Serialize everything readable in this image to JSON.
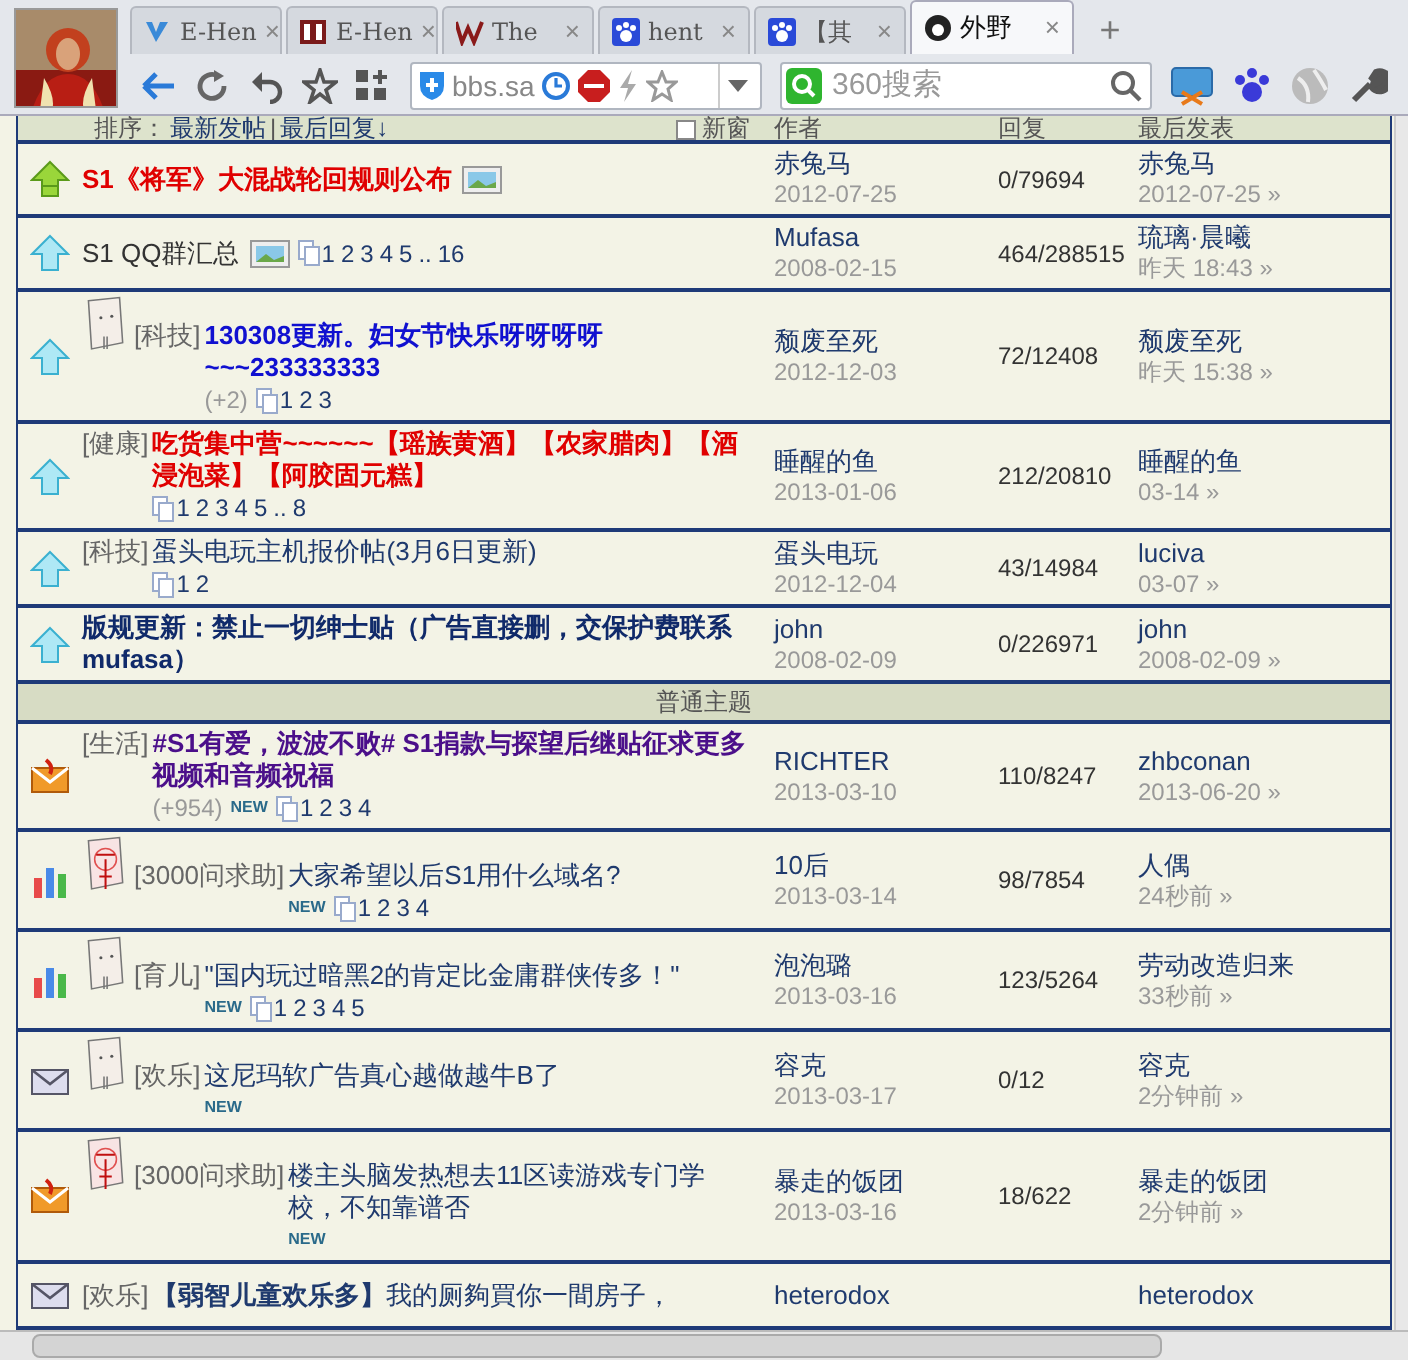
{
  "browser": {
    "tabs": [
      {
        "label": "E-Hen",
        "kind": "v",
        "close": "×",
        "selected": false
      },
      {
        "label": "E-Hen",
        "kind": "eh",
        "close": "×",
        "selected": false
      },
      {
        "label": "The",
        "kind": "w",
        "close": "×",
        "selected": false
      },
      {
        "label": "hent",
        "kind": "paw",
        "close": "×",
        "selected": false
      },
      {
        "label": "【其",
        "kind": "paw",
        "close": "×",
        "selected": false
      },
      {
        "label": "外野",
        "kind": "globe",
        "close": "×",
        "selected": true
      }
    ],
    "new_tab": "+",
    "address": "bbs.sa",
    "search_placeholder": "360搜索"
  },
  "list_header": {
    "sort_label": "排序：",
    "sort_options": [
      "最新发帖",
      "最后回复↓"
    ],
    "separator": "|",
    "new_window": {
      "label": "新窗",
      "checked": false
    },
    "columns": [
      "作者",
      "回复",
      "最后发表"
    ]
  },
  "rows": [
    {
      "kind": "pin_global",
      "title": "S1《将军》大混战轮回规则公布",
      "color": "#e00000",
      "bold": true,
      "image": true,
      "author": "赤兔马",
      "date": "2012-07-25",
      "replies": "0/79694",
      "last_poster": "赤兔马",
      "last_time": "2012-07-25 »"
    },
    {
      "kind": "pin",
      "title": "S1 QQ群汇总",
      "color": "#333333",
      "bold": false,
      "image": true,
      "pages": [
        "1",
        "2",
        "3",
        "4",
        "5",
        "..",
        "16"
      ],
      "author": "Mufasa",
      "date": "2008-02-15",
      "replies": "464/288515",
      "last_poster": "琉璃·晨曦",
      "last_time": "昨天 18:43 »"
    },
    {
      "kind": "pin",
      "sticker": {
        "kind": "plain"
      },
      "prefix": "[科技]",
      "title": "130308更新。妇女节快乐呀呀呀呀~~~233333333",
      "color": "#1010d0",
      "bold": true,
      "rating": "(+2)",
      "pages": [
        "1",
        "2",
        "3"
      ],
      "author": "颓废至死",
      "date": "2012-12-03",
      "replies": "72/12408",
      "last_poster": "颓废至死",
      "last_time": "昨天 15:38 »"
    },
    {
      "kind": "pin",
      "prefix": "[健康]",
      "title": "吃货集中营~~~~~~【瑶族黄酒】【农家腊肉】【酒浸泡菜】【阿胶固元糕】",
      "color": "#e00000",
      "bold": true,
      "pages": [
        "1",
        "2",
        "3",
        "4",
        "5",
        "..",
        "8"
      ],
      "author": "睡醒的鱼",
      "date": "2013-01-06",
      "replies": "212/20810",
      "last_poster": "睡醒的鱼",
      "last_time": "03-14 »"
    },
    {
      "kind": "pin",
      "prefix": "[科技]",
      "title": "蛋头电玩主机报价帖(3月6日更新)",
      "color": "#1f3a6e",
      "bold": false,
      "pages": [
        "1",
        "2"
      ],
      "author": "蛋头电玩",
      "date": "2012-12-04",
      "replies": "43/14984",
      "last_poster": "luciva",
      "last_time": "03-07 »"
    },
    {
      "kind": "pin",
      "title": "版规更新：禁止一切绅士贴（广告直接删，交保护费联系mufasa）",
      "color": "#102a6a",
      "bold": true,
      "author": "john",
      "date": "2008-02-09",
      "replies": "0/226971",
      "last_poster": "john",
      "last_time": "2008-02-09 »"
    }
  ],
  "section": "普通主题",
  "rows2": [
    {
      "kind": "hot",
      "prefix": "[生活]",
      "title": "#S1有爱，波波不败# S1捐款与探望后继贴征求更多视频和音频祝福",
      "color": "#4b0f8a",
      "bold": true,
      "rating": "(+954)",
      "new": "NEW",
      "pages": [
        "1",
        "2",
        "3",
        "4"
      ],
      "author": "RICHTER",
      "date": "2013-03-10",
      "replies": "110/8247",
      "last_poster": "zhbconan",
      "last_time": "2013-06-20 »"
    },
    {
      "kind": "poll",
      "sticker": {
        "kind": "marked"
      },
      "prefix": "[3000问求助]",
      "title": "大家希望以后S1用什么域名?",
      "color": "#1f3a6e",
      "bold": false,
      "new": "NEW",
      "pages": [
        "1",
        "2",
        "3",
        "4"
      ],
      "author": "10后",
      "date": "2013-03-14",
      "replies": "98/7854",
      "last_poster": "人偶",
      "last_time": "24秒前 »"
    },
    {
      "kind": "poll",
      "sticker": {
        "kind": "plain"
      },
      "prefix": "[育儿]",
      "title": "\"国内玩过暗黑2的肯定比金庸群侠传多！\"",
      "color": "#1f3a6e",
      "bold": false,
      "new": "NEW",
      "pages": [
        "1",
        "2",
        "3",
        "4",
        "5"
      ],
      "author": "泡泡璐",
      "date": "2013-03-16",
      "replies": "123/5264",
      "last_poster": "劳动改造归来",
      "last_time": "33秒前 »"
    },
    {
      "kind": "normal",
      "sticker": {
        "kind": "plain"
      },
      "prefix": "[欢乐]",
      "title": "这尼玛软广告真心越做越牛B了",
      "color": "#1f3a6e",
      "bold": false,
      "new": "NEW",
      "author": "容克",
      "date": "2013-03-17",
      "replies": "0/12",
      "last_poster": "容克",
      "last_time": "2分钟前 »"
    },
    {
      "kind": "hot",
      "sticker": {
        "kind": "marked"
      },
      "prefix": "[3000问求助]",
      "title": "楼主头脑发热想去11区读游戏专门学校，不知靠谱否",
      "color": "#1f3a6e",
      "bold": false,
      "new": "NEW",
      "author": "暴走的饭团",
      "date": "2013-03-16",
      "replies": "18/622",
      "last_poster": "暴走的饭团",
      "last_time": "2分钟前 »"
    },
    {
      "kind": "normal",
      "prefix": "[欢乐]",
      "title": "**【弱智儿童欢乐多】**我的厕夠買你一間房子，",
      "color": "#1f3a6e",
      "bold": false,
      "author": "heterodox",
      "last_poster": "heterodox"
    }
  ]
}
